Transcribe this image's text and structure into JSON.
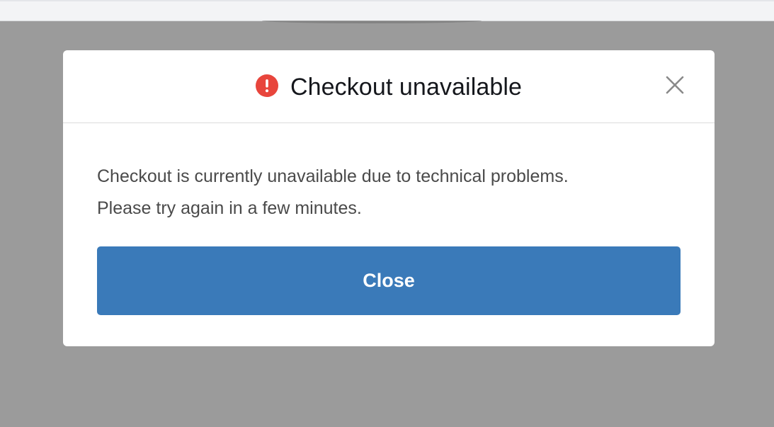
{
  "modal": {
    "title": "Checkout unavailable",
    "title_icon": "alert-circle-icon",
    "close_icon": "close-icon",
    "message_line1": "Checkout is currently unavailable due to technical problems.",
    "message_line2": "Please try again in a few minutes.",
    "button_label": "Close"
  },
  "colors": {
    "overlay": "#9b9b9b",
    "alert_icon": "#e8453c",
    "button": "#3a7ab9",
    "title_text": "#15171c",
    "body_text": "#4a4a4a"
  }
}
